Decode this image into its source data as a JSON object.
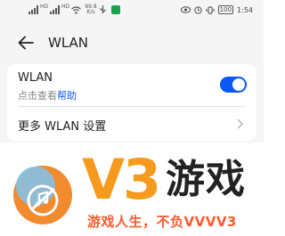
{
  "status_bar": {
    "net_tag": "HD",
    "speed_value": "99.8",
    "speed_unit": "K/s",
    "battery": "100",
    "time": "1:54"
  },
  "header": {
    "title": "WLAN"
  },
  "wlan": {
    "title": "WLAN",
    "subtitle": "点击查看",
    "help_link": "帮助",
    "enabled": true,
    "accent_color": "#0a59f7"
  },
  "more_settings": {
    "label": "更多 WLAN 设置"
  },
  "watermark": {
    "brand_mark": "V3",
    "brand_name": "游戏",
    "slogan": "游戏人生，不负VVVV3",
    "brand_color": "#f59a1d",
    "slogan_color": "#ff5a2c"
  }
}
